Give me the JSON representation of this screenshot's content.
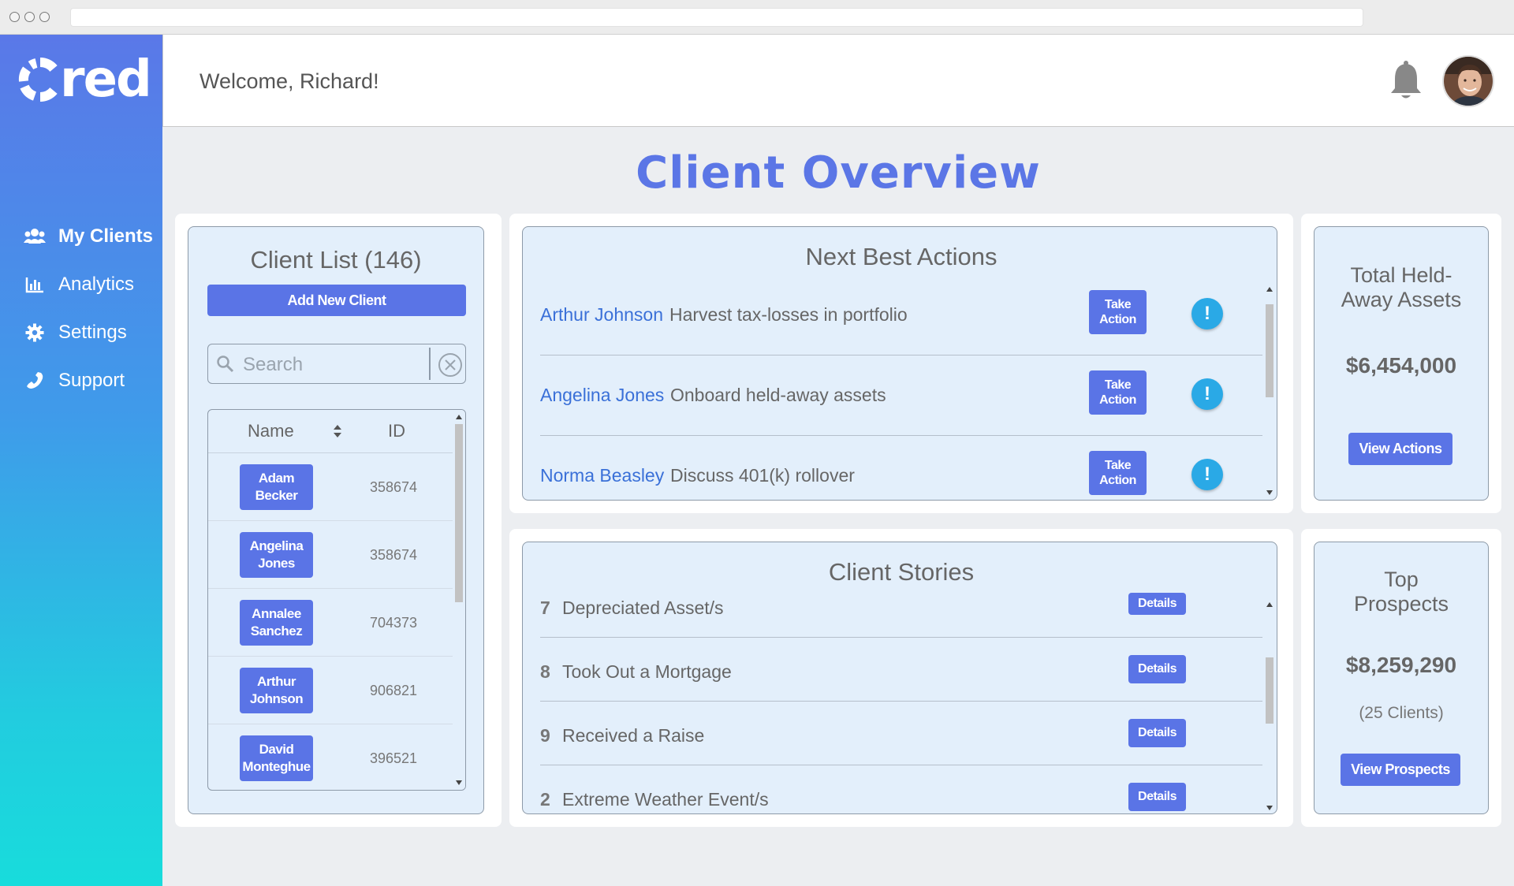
{
  "app": {
    "brand": "red",
    "welcome": "Welcome, Richard!",
    "colors": {
      "accent": "#5a74e6",
      "link": "#3a70d8",
      "title": "#5b76e6",
      "alert": "#2aa9e6",
      "panel": "#e3effb"
    }
  },
  "nav": [
    {
      "label": "My Clients",
      "icon": "users-icon",
      "active": true
    },
    {
      "label": "Analytics",
      "icon": "bar-chart-icon",
      "active": false
    },
    {
      "label": "Settings",
      "icon": "gear-icon",
      "active": false
    },
    {
      "label": "Support",
      "icon": "phone-icon",
      "active": false
    }
  ],
  "page": {
    "title": "Client Overview"
  },
  "client_list": {
    "title": "Client List (146)",
    "add_label": "Add New Client",
    "search_placeholder": "Search",
    "columns": {
      "name": "Name",
      "id": "ID"
    },
    "rows": [
      {
        "first": "Adam",
        "last": "Becker",
        "id": "358674"
      },
      {
        "first": "Angelina",
        "last": "Jones",
        "id": "358674"
      },
      {
        "first": "Annalee",
        "last": "Sanchez",
        "id": "704373"
      },
      {
        "first": "Arthur",
        "last": "Johnson",
        "id": "906821"
      },
      {
        "first": "David",
        "last": "Monteghue",
        "id": "396521"
      }
    ]
  },
  "next_best_actions": {
    "title": "Next Best Actions",
    "button_line1": "Take",
    "button_line2": "Action",
    "alert_glyph": "!",
    "items": [
      {
        "client": "Arthur Johnson",
        "action": "Harvest tax-losses in portfolio"
      },
      {
        "client": "Angelina Jones",
        "action": "Onboard held-away assets"
      },
      {
        "client": "Norma Beasley",
        "action": "Discuss 401(k) rollover"
      }
    ]
  },
  "client_stories": {
    "title": "Client Stories",
    "button_label": "Details",
    "items": [
      {
        "count": "7",
        "label": "Depreciated Asset/s"
      },
      {
        "count": "8",
        "label": "Took Out a Mortgage"
      },
      {
        "count": "9",
        "label": "Received a Raise"
      },
      {
        "count": "2",
        "label": "Extreme Weather Event/s"
      }
    ]
  },
  "held_away": {
    "title_line1": "Total Held-",
    "title_line2": "Away Assets",
    "value": "$6,454,000",
    "button": "View Actions"
  },
  "prospects": {
    "title_line1": "Top",
    "title_line2": "Prospects",
    "value": "$8,259,290",
    "sub": "(25 Clients)",
    "button": "View Prospects"
  }
}
